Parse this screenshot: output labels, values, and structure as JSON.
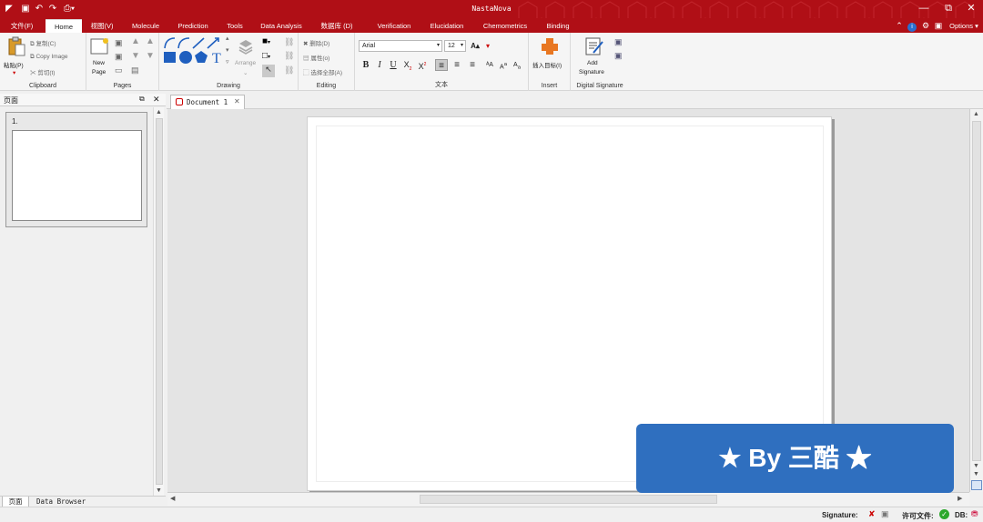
{
  "app_title": "NastaNova",
  "window_buttons": {
    "minimize": "—",
    "maximize": "⧉",
    "close": "✕"
  },
  "tabs": [
    {
      "label": "文件(F)"
    },
    {
      "label": "Home"
    },
    {
      "label": "视图(V)"
    },
    {
      "label": "Molecule"
    },
    {
      "label": "Prediction"
    },
    {
      "label": "Tools"
    },
    {
      "label": "Data Analysis"
    },
    {
      "label": "数据库 (D)"
    },
    {
      "label": "Verification"
    },
    {
      "label": "Elucidation"
    },
    {
      "label": "Chemometrics"
    },
    {
      "label": "Binding"
    }
  ],
  "options_label": "Options",
  "clipboard": {
    "paste": "粘贴(P)",
    "copy": "复制(C)",
    "copy_image": "Copy Image",
    "cut": "剪切(t)",
    "label": "Clipboard"
  },
  "pages": {
    "new_page_line1": "New",
    "new_page_line2": "Page",
    "label": "Pages"
  },
  "drawing": {
    "arrange": "Arrange",
    "label": "Drawing"
  },
  "editing": {
    "delete": "删除(D)",
    "properties": "属性(o)",
    "select_all": "选择全部(A)",
    "label": "Editing"
  },
  "text_group": {
    "font": "Arial",
    "size": "12",
    "label": "文本"
  },
  "insert": {
    "insert_object": "插入目标(I)",
    "label": "Insert"
  },
  "digital_signature": {
    "add_line1": "Add",
    "add_line2": "Signature",
    "label": "Digital Signature"
  },
  "left_panel": {
    "title": "页面",
    "page_number": "1.",
    "bottom_tab_pages": "页面",
    "bottom_tab_browser": "Data Browser"
  },
  "document_tab": {
    "label": "Document 1"
  },
  "status": {
    "signature": "Signature:",
    "license": "许可文件:",
    "db": "DB:"
  },
  "watermark": "★ By 三酷 ★",
  "colors": {
    "brand": "#b00f16",
    "watermark": "#2f6fbf"
  }
}
